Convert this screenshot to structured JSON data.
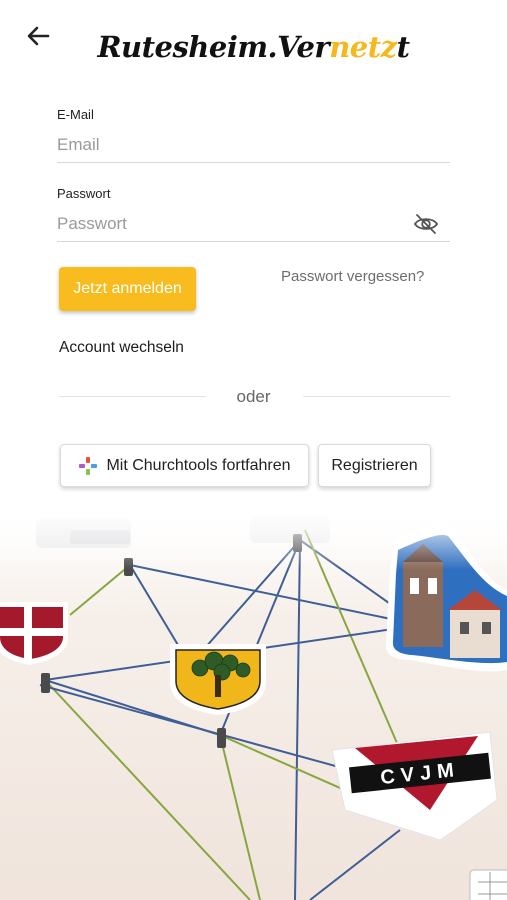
{
  "header": {
    "back_icon": "arrow-left-icon",
    "logo_part1": "Rutesheim.Ver",
    "logo_accent": "netz",
    "logo_part2": "t"
  },
  "form": {
    "email_label": "E-Mail",
    "email_placeholder": "Email",
    "email_value": "",
    "password_label": "Passwort",
    "password_placeholder": "Passwort",
    "password_value": "",
    "eye_icon": "eye-off-icon",
    "login_button": "Jetzt anmelden",
    "forgot_link": "Passwort vergessen?",
    "switch_account": "Account wechseln",
    "or_text": "oder",
    "churchtools_button": "Mit Churchtools fortfahren",
    "churchtools_icon": "churchtools-logo-icon",
    "register_button": "Registrieren"
  },
  "hero": {
    "banner_text": "CVJM"
  },
  "colors": {
    "accent": "#f8bc1f",
    "logo_accent": "#f5b81d"
  }
}
